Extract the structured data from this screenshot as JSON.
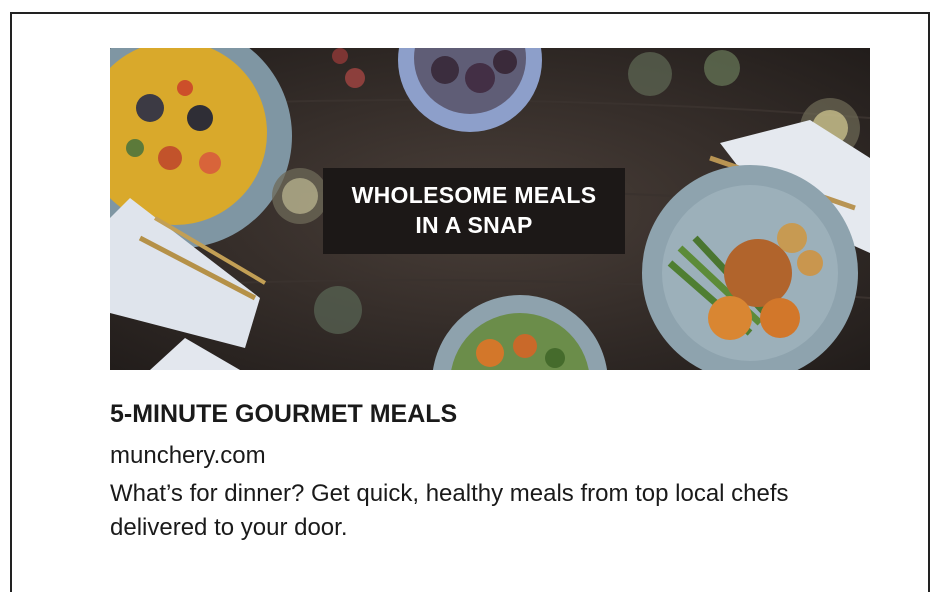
{
  "ad": {
    "hero_text_line1": "WHOLESOME MEALS",
    "hero_text_line2": "IN A SNAP",
    "headline": "5-MINUTE GOURMET MEALS",
    "domain": "munchery.com",
    "description": "What’s for dinner? Get quick, healthy meals from top local chefs delivered to your door."
  },
  "colors": {
    "table": "#2f2a27",
    "plate": "#8fa3ad",
    "label_bg": "#1c1817",
    "text": "#1a1a1a"
  }
}
